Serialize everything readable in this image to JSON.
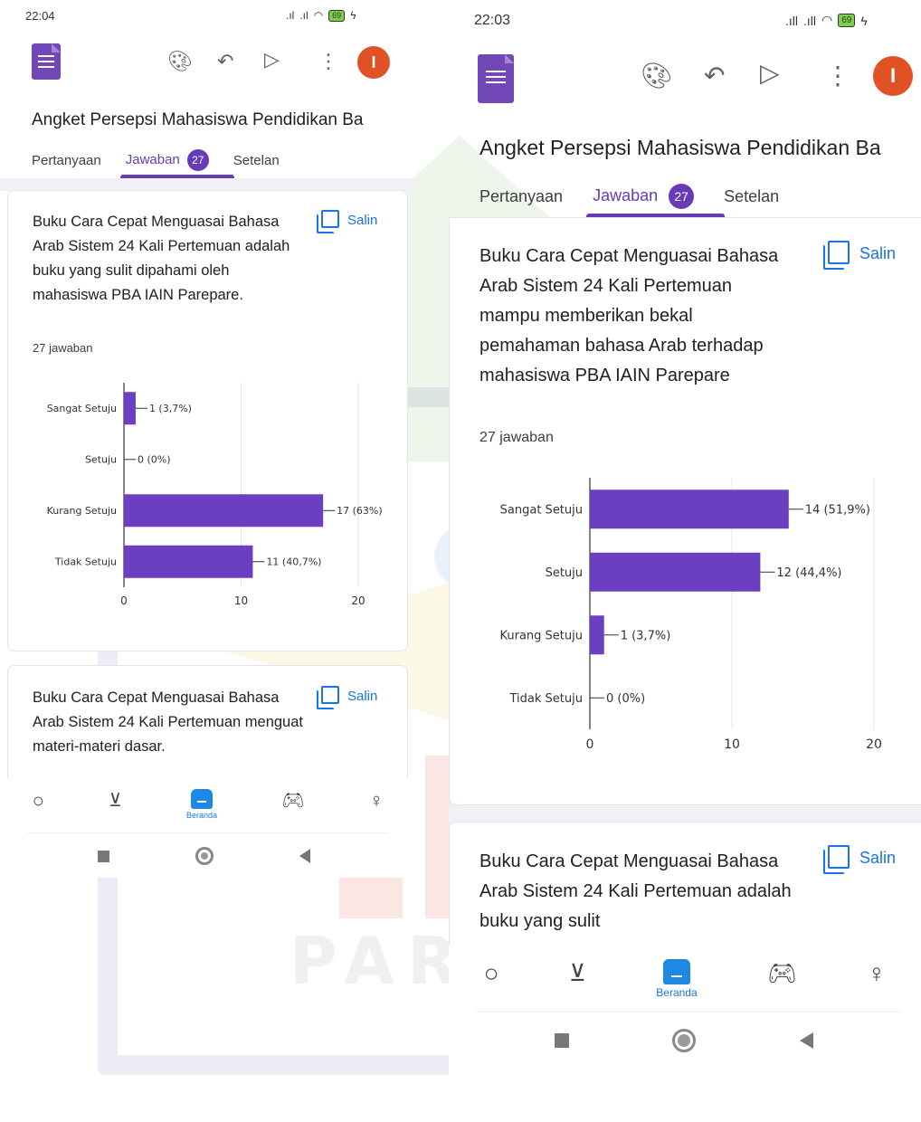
{
  "screens": [
    {
      "status_time": "22:04",
      "battery": "69",
      "form_title": "Angket Persepsi Mahasiswa Pendidikan Ba",
      "tabs": {
        "questions": "Pertanyaan",
        "responses": "Jawaban",
        "responses_count": "27",
        "settings": "Setelan"
      },
      "cards": [
        {
          "question": "Buku Cara Cepat Menguasai Bahasa Arab Sistem 24 Kali Pertemuan adalah buku yang sulit dipahami oleh mahasiswa PBA IAIN Parepare.",
          "response_count": "27 jawaban",
          "copy_label": "Salin"
        },
        {
          "question": "Buku Cara Cepat Menguasai Bahasa Arab Sistem 24 Kali Pertemuan menguat materi-materi dasar.",
          "copy_label": "Salin"
        }
      ],
      "nav": {
        "home_label": "Beranda"
      }
    },
    {
      "status_time": "22:03",
      "battery": "69",
      "form_title": "Angket Persepsi Mahasiswa Pendidikan Ba",
      "tabs": {
        "questions": "Pertanyaan",
        "responses": "Jawaban",
        "responses_count": "27",
        "settings": "Setelan"
      },
      "cards": [
        {
          "question": "Buku Cara Cepat Menguasai Bahasa Arab Sistem 24 Kali Pertemuan mampu memberikan bekal pemahaman bahasa Arab terhadap mahasiswa PBA IAIN Parepare",
          "response_count": "27 jawaban",
          "copy_label": "Salin"
        },
        {
          "question": "Buku Cara Cepat Menguasai Bahasa Arab Sistem 24 Kali Pertemuan adalah buku yang sulit",
          "copy_label": "Salin"
        }
      ],
      "nav": {
        "home_label": "Beranda"
      }
    }
  ],
  "colors": {
    "accent": "#673ab7",
    "bar": "#6a3fc0",
    "link": "#1a73e8",
    "avatar": "#e05123"
  },
  "chart_data": [
    {
      "type": "bar",
      "orientation": "horizontal",
      "categories": [
        "Sangat Setuju",
        "Setuju",
        "Kurang Setuju",
        "Tidak Setuju"
      ],
      "values": [
        1,
        0,
        17,
        11
      ],
      "labels": [
        "1 (3,7%)",
        "0 (0%)",
        "17 (63%)",
        "11 (40,7%)"
      ],
      "xlim": [
        0,
        20
      ],
      "xticks": [
        0,
        10,
        20
      ],
      "grid": true
    },
    {
      "type": "bar",
      "orientation": "horizontal",
      "categories": [
        "Sangat Setuju",
        "Setuju",
        "Kurang Setuju",
        "Tidak Setuju"
      ],
      "values": [
        14,
        12,
        1,
        0
      ],
      "labels": [
        "14 (51,9%)",
        "12 (44,4%)",
        "1 (3,7%)",
        "0 (0%)"
      ],
      "xlim": [
        0,
        20
      ],
      "xticks": [
        0,
        10,
        20
      ],
      "grid": true
    }
  ]
}
